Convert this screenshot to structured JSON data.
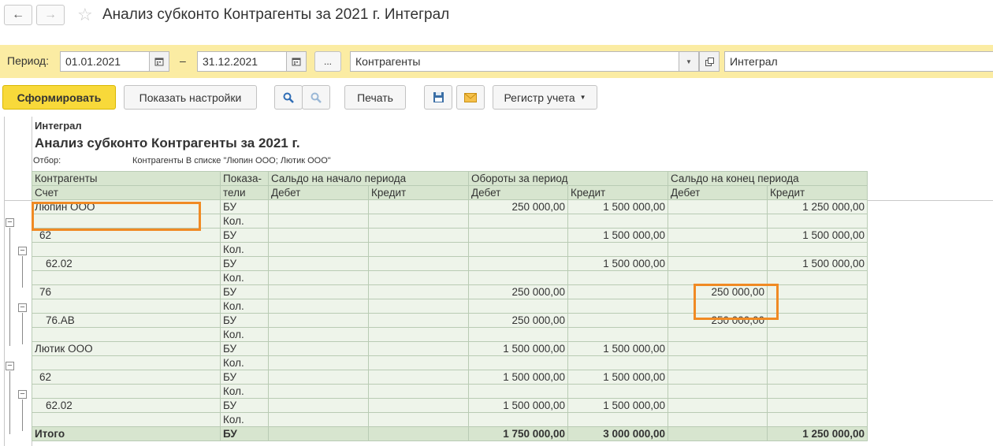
{
  "window": {
    "title": "Анализ субконто Контрагенты за 2021 г. Интеграл"
  },
  "icons": {
    "back": "arrow-left-icon",
    "forward": "arrow-right-icon",
    "favorite": "star-icon",
    "calendar": "calendar-icon",
    "dropdown": "chevron-down-icon",
    "open": "open-form-icon",
    "search": "search-icon",
    "cancel_search": "cancel-search-icon",
    "save": "floppy-icon",
    "mail": "envelope-icon"
  },
  "filters": {
    "period_label": "Период:",
    "date_from": "01.01.2021",
    "dash": "–",
    "date_to": "31.12.2021",
    "ellipsis": "...",
    "subconto": "Контрагенты",
    "organization": "Интеграл"
  },
  "toolbar": {
    "generate": "Сформировать",
    "show_settings": "Показать настройки",
    "print": "Печать",
    "register": "Регистр учета"
  },
  "report": {
    "organization": "Интеграл",
    "title": "Анализ субконто Контрагенты за 2021 г.",
    "filter_label": "Отбор:",
    "filter_value": "Контрагенты В списке \"Люпин ООО; Лютик ООО\"",
    "headers": {
      "counterparty": "Контрагенты",
      "account": "Счет",
      "indicator_1": "Показа-",
      "indicator_2": "тели",
      "opening": "Сальдо на начало периода",
      "turnover": "Обороты за период",
      "closing": "Сальдо на конец периода",
      "debit": "Дебет",
      "credit": "Кредит"
    },
    "rows": [
      {
        "name": "Люпин ООО",
        "ind": "БУ",
        "od": "",
        "oc": "",
        "td": "250 000,00",
        "tc": "1 500 000,00",
        "cd": "",
        "cc": "1 250 000,00"
      },
      {
        "name": "",
        "ind": "Кол.",
        "od": "",
        "oc": "",
        "td": "",
        "tc": "",
        "cd": "",
        "cc": ""
      },
      {
        "name": "62",
        "ind": "БУ",
        "od": "",
        "oc": "",
        "td": "",
        "tc": "1 500 000,00",
        "cd": "",
        "cc": "1 500 000,00"
      },
      {
        "name": "",
        "ind": "Кол.",
        "od": "",
        "oc": "",
        "td": "",
        "tc": "",
        "cd": "",
        "cc": ""
      },
      {
        "name": "62.02",
        "ind": "БУ",
        "od": "",
        "oc": "",
        "td": "",
        "tc": "1 500 000,00",
        "cd": "",
        "cc": "1 500 000,00"
      },
      {
        "name": "",
        "ind": "Кол.",
        "od": "",
        "oc": "",
        "td": "",
        "tc": "",
        "cd": "",
        "cc": ""
      },
      {
        "name": "76",
        "ind": "БУ",
        "od": "",
        "oc": "",
        "td": "250 000,00",
        "tc": "",
        "cd": "250 000,00",
        "cc": ""
      },
      {
        "name": "",
        "ind": "Кол.",
        "od": "",
        "oc": "",
        "td": "",
        "tc": "",
        "cd": "",
        "cc": ""
      },
      {
        "name": "76.АВ",
        "ind": "БУ",
        "od": "",
        "oc": "",
        "td": "250 000,00",
        "tc": "",
        "cd": "250 000,00",
        "cc": ""
      },
      {
        "name": "",
        "ind": "Кол.",
        "od": "",
        "oc": "",
        "td": "",
        "tc": "",
        "cd": "",
        "cc": ""
      },
      {
        "name": "Лютик ООО",
        "ind": "БУ",
        "od": "",
        "oc": "",
        "td": "1 500 000,00",
        "tc": "1 500 000,00",
        "cd": "",
        "cc": ""
      },
      {
        "name": "",
        "ind": "Кол.",
        "od": "",
        "oc": "",
        "td": "",
        "tc": "",
        "cd": "",
        "cc": ""
      },
      {
        "name": "62",
        "ind": "БУ",
        "od": "",
        "oc": "",
        "td": "1 500 000,00",
        "tc": "1 500 000,00",
        "cd": "",
        "cc": ""
      },
      {
        "name": "",
        "ind": "Кол.",
        "od": "",
        "oc": "",
        "td": "",
        "tc": "",
        "cd": "",
        "cc": ""
      },
      {
        "name": "62.02",
        "ind": "БУ",
        "od": "",
        "oc": "",
        "td": "1 500 000,00",
        "tc": "1 500 000,00",
        "cd": "",
        "cc": ""
      },
      {
        "name": "",
        "ind": "Кол.",
        "od": "",
        "oc": "",
        "td": "",
        "tc": "",
        "cd": "",
        "cc": ""
      },
      {
        "name": "Итого",
        "ind": "БУ",
        "od": "",
        "oc": "",
        "td": "1 750 000,00",
        "tc": "3 000 000,00",
        "cd": "",
        "cc": "1 250 000,00"
      }
    ]
  }
}
